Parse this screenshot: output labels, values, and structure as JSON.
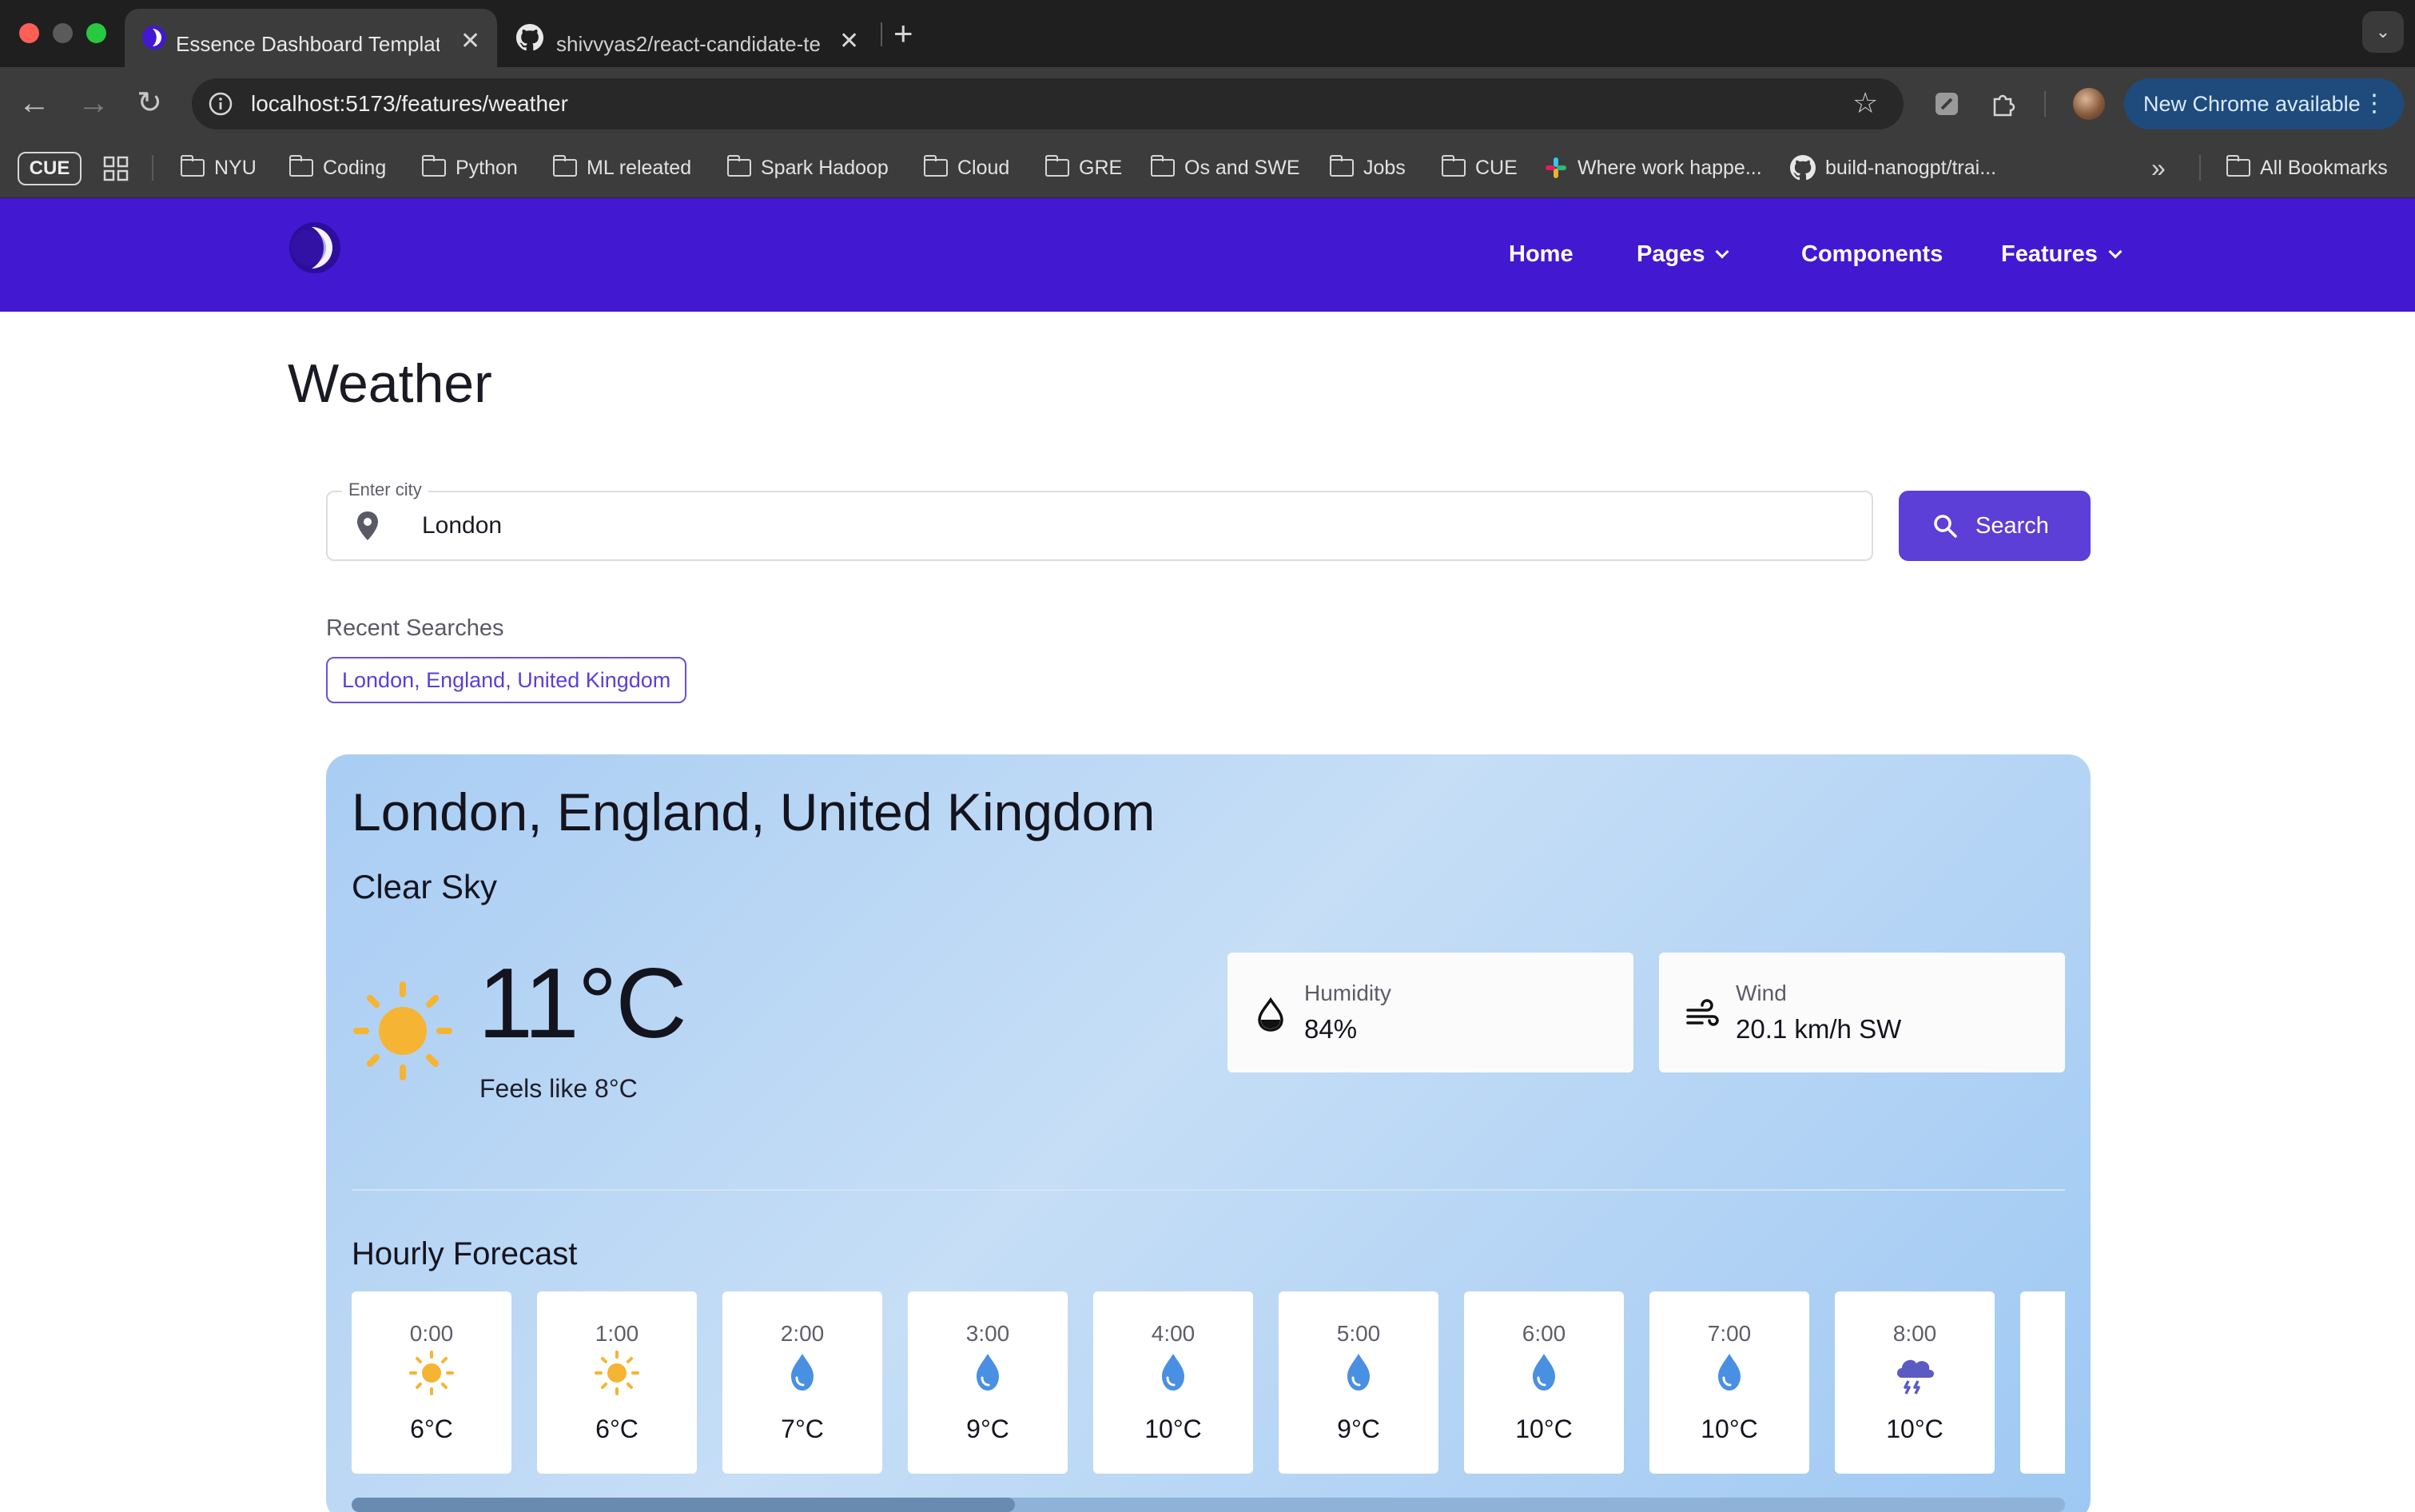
{
  "browser": {
    "tabs": [
      {
        "title": "Essence Dashboard Template",
        "active": true
      },
      {
        "title": "shivvyas2/react-candidate-te",
        "active": false
      }
    ],
    "url": "localhost:5173/features/weather",
    "update_label": "New Chrome available",
    "bookmarks": [
      {
        "label": "CUE",
        "kind": "chip"
      },
      {
        "label": "NYU",
        "kind": "folder"
      },
      {
        "label": "Coding",
        "kind": "folder"
      },
      {
        "label": "Python",
        "kind": "folder"
      },
      {
        "label": "ML releated",
        "kind": "folder"
      },
      {
        "label": "Spark Hadoop",
        "kind": "folder"
      },
      {
        "label": "Cloud",
        "kind": "folder"
      },
      {
        "label": "GRE",
        "kind": "folder"
      },
      {
        "label": "Os and SWE",
        "kind": "folder"
      },
      {
        "label": "Jobs",
        "kind": "folder"
      },
      {
        "label": "CUE",
        "kind": "folder"
      },
      {
        "label": "Where work happe...",
        "kind": "slack"
      },
      {
        "label": "build-nanogpt/trai...",
        "kind": "github"
      }
    ],
    "all_bookmarks_label": "All Bookmarks"
  },
  "nav": {
    "links": [
      "Home",
      "Pages",
      "Components",
      "Features"
    ],
    "brand_color": "#4318d1"
  },
  "page": {
    "title": "Weather",
    "search": {
      "label": "Enter city",
      "value": "London",
      "button_label": "Search"
    },
    "recent": {
      "label": "Recent Searches",
      "items": [
        "London, England, United Kingdom"
      ]
    },
    "weather": {
      "location": "London, England, United Kingdom",
      "condition": "Clear Sky",
      "temperature": "11°C",
      "feels_like": "Feels like 8°C",
      "icon": "sun-icon",
      "humidity": {
        "label": "Humidity",
        "value": "84%",
        "icon": "droplet-icon"
      },
      "wind": {
        "label": "Wind",
        "value": "20.1 km/h SW",
        "icon": "wind-icon"
      }
    },
    "hourly": {
      "title": "Hourly Forecast",
      "items": [
        {
          "time": "0:00",
          "temp": "6°C",
          "icon": "sun-icon"
        },
        {
          "time": "1:00",
          "temp": "6°C",
          "icon": "sun-icon"
        },
        {
          "time": "2:00",
          "temp": "7°C",
          "icon": "rain-drop-icon"
        },
        {
          "time": "3:00",
          "temp": "9°C",
          "icon": "rain-drop-icon"
        },
        {
          "time": "4:00",
          "temp": "10°C",
          "icon": "rain-drop-icon"
        },
        {
          "time": "5:00",
          "temp": "9°C",
          "icon": "rain-drop-icon"
        },
        {
          "time": "6:00",
          "temp": "10°C",
          "icon": "rain-drop-icon"
        },
        {
          "time": "7:00",
          "temp": "10°C",
          "icon": "rain-drop-icon"
        },
        {
          "time": "8:00",
          "temp": "10°C",
          "icon": "thunderstorm-icon"
        }
      ]
    },
    "colors": {
      "accent": "#5b3fd6",
      "sun": "#f5b433",
      "drop": "#4a90e2",
      "storm": "#5b5bc4"
    }
  }
}
